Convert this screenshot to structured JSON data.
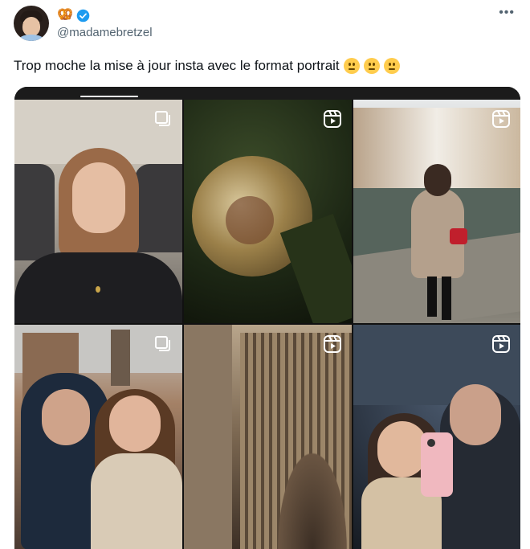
{
  "post": {
    "handle": "@madamebretzel",
    "text": "Trop moche la mise à jour insta avec le format portrait",
    "emojis": [
      "neutral-face",
      "neutral-face",
      "neutral-face"
    ]
  },
  "icons": {
    "badge": "pretzel-icon",
    "verified": "verified-icon",
    "more": "more-icon",
    "multi": "carousel-icon",
    "reel": "reel-icon"
  },
  "colors": {
    "handle": "#536471",
    "text": "#0f1419",
    "verified": "#1d9bf0",
    "media_bg": "#111111"
  },
  "grid": {
    "tiles": [
      {
        "name": "selfie-car",
        "icon": "carousel-icon"
      },
      {
        "name": "christmas-ornament",
        "icon": "reel-icon"
      },
      {
        "name": "canal-walk",
        "icon": "reel-icon"
      },
      {
        "name": "couple-selfie",
        "icon": "carousel-icon"
      },
      {
        "name": "cathedral-facade",
        "icon": "reel-icon"
      },
      {
        "name": "mirror-selfie",
        "icon": "reel-icon"
      }
    ]
  }
}
